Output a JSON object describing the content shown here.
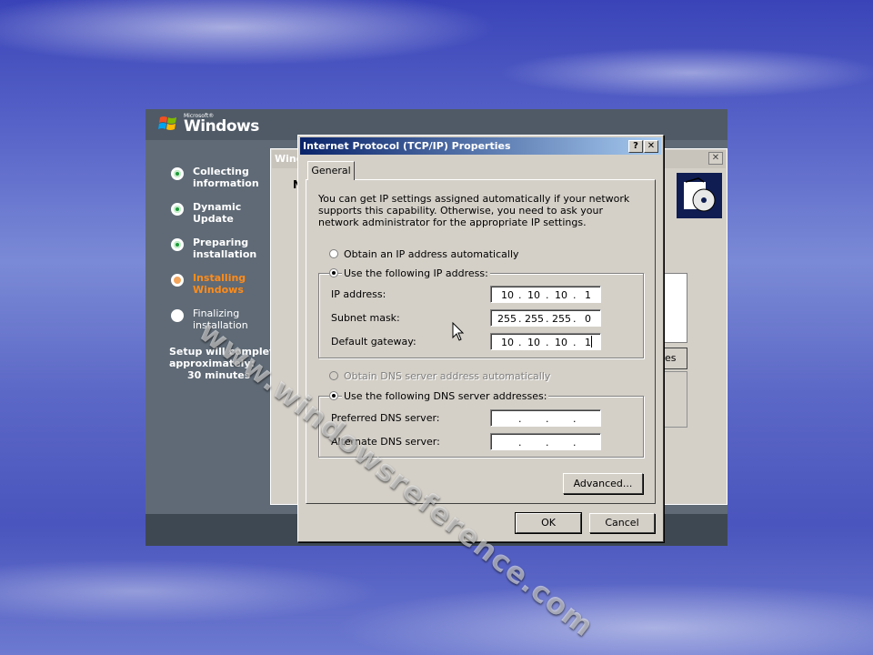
{
  "setup": {
    "brand_small": "Microsoft®",
    "brand": "Windows",
    "steps": [
      {
        "line1": "Collecting",
        "line2": "information",
        "state": "done"
      },
      {
        "line1": "Dynamic",
        "line2": "Update",
        "state": "done"
      },
      {
        "line1": "Preparing",
        "line2": "installation",
        "state": "done"
      },
      {
        "line1": "Installing",
        "line2": "Windows",
        "state": "current"
      },
      {
        "line1": "Finalizing",
        "line2": "installation",
        "state": "future"
      }
    ],
    "eta_line1": "Setup will complete",
    "eta_line2": "approximately:",
    "eta_value": "30 minutes"
  },
  "background_window": {
    "title": "Windo",
    "heading_fragment": "N",
    "button_fragment": "es"
  },
  "dialog": {
    "title": "Internet Protocol (TCP/IP) Properties",
    "help_glyph": "?",
    "close_glyph": "✕",
    "tab_general": "General",
    "intro": "You can get IP settings assigned automatically if your network supports this capability. Otherwise, you need to ask your network administrator for the appropriate IP settings.",
    "ip_auto_label": "Obtain an IP address automatically",
    "ip_manual_label": "Use the following IP address:",
    "ip_mode": "manual",
    "ip_address_label": "IP address:",
    "ip_address": [
      "10",
      "10",
      "10",
      "1"
    ],
    "subnet_label": "Subnet mask:",
    "subnet": [
      "255",
      "255",
      "255",
      "0"
    ],
    "gateway_label": "Default gateway:",
    "gateway": [
      "10",
      "10",
      "10",
      "1"
    ],
    "dns_auto_label": "Obtain DNS server address automatically",
    "dns_manual_label": "Use the following DNS server addresses:",
    "dns_mode": "manual",
    "preferred_dns_label": "Preferred DNS server:",
    "preferred_dns": [
      "",
      "",
      "",
      ""
    ],
    "alternate_dns_label": "Alternate DNS server:",
    "alternate_dns": [
      "",
      "",
      "",
      ""
    ],
    "advanced_button": "Advanced...",
    "ok_button": "OK",
    "cancel_button": "Cancel"
  },
  "watermark": "www.windowsreference.com",
  "colors": {
    "titlebar_start": "#0a246a",
    "titlebar_end": "#a6caf0",
    "dialog_face": "#d4d0c8",
    "current_step": "#ff8c1a",
    "done_step": "#1f9a3a",
    "setup_sidebar": "#5f6a76"
  }
}
